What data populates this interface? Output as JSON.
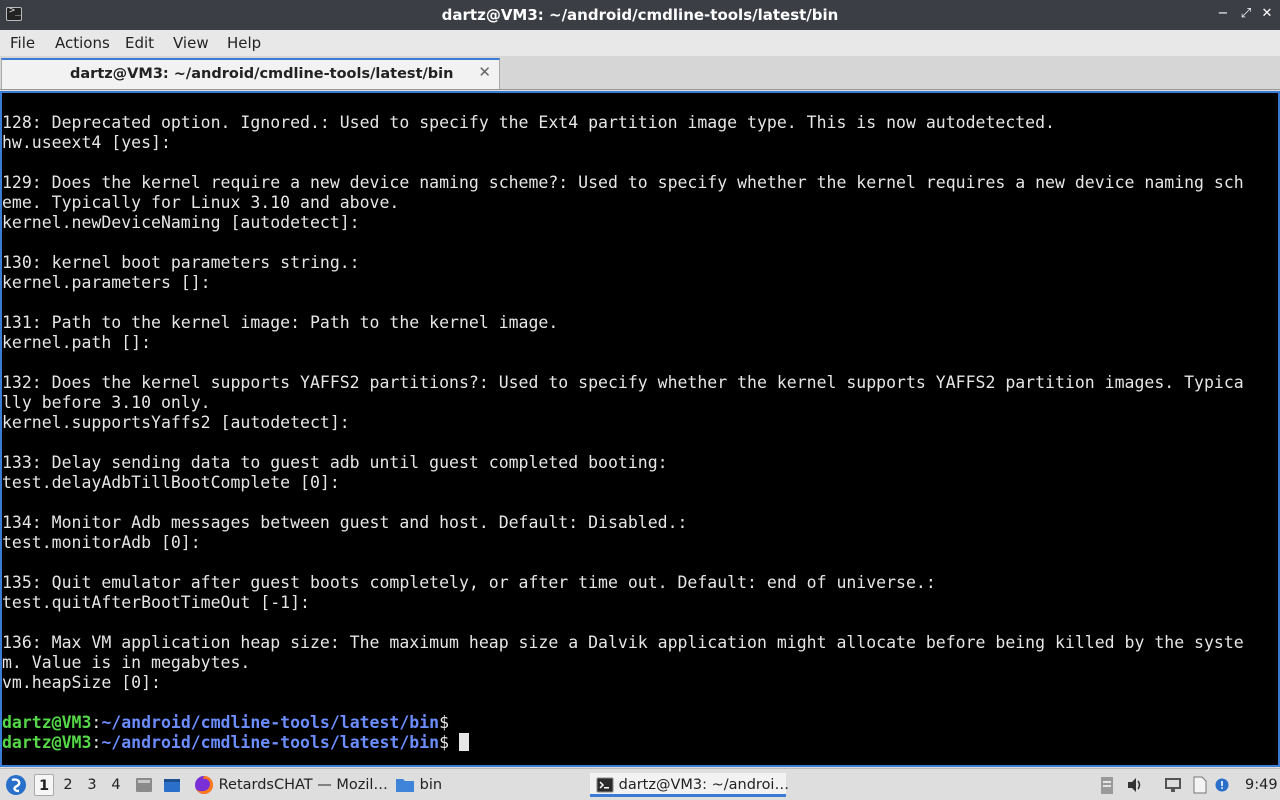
{
  "window": {
    "title": "dartz@VM3: ~/android/cmdline-tools/latest/bin",
    "app_icon_glyph": ">_",
    "controls": {
      "minimize": "−",
      "restore": "⤢",
      "close": "✕"
    }
  },
  "menu": [
    "File",
    "Actions",
    "Edit",
    "View",
    "Help"
  ],
  "tab": {
    "label": "dartz@VM3: ~/android/cmdline-tools/latest/bin",
    "close": "✕"
  },
  "terminal": {
    "lines": [
      "128: Deprecated option. Ignored.: Used to specify the Ext4 partition image type. This is now autodetected.",
      "hw.useext4 [yes]:",
      "",
      "129: Does the kernel require a new device naming scheme?: Used to specify whether the kernel requires a new device naming sch",
      "eme. Typically for Linux 3.10 and above.",
      "kernel.newDeviceNaming [autodetect]:",
      "",
      "130: kernel boot parameters string.:",
      "kernel.parameters []:",
      "",
      "131: Path to the kernel image: Path to the kernel image.",
      "kernel.path []:",
      "",
      "132: Does the kernel supports YAFFS2 partitions?: Used to specify whether the kernel supports YAFFS2 partition images. Typica",
      "lly before 3.10 only.",
      "kernel.supportsYaffs2 [autodetect]:",
      "",
      "133: Delay sending data to guest adb until guest completed booting:",
      "test.delayAdbTillBootComplete [0]:",
      "",
      "134: Monitor Adb messages between guest and host. Default: Disabled.:",
      "test.monitorAdb [0]:",
      "",
      "135: Quit emulator after guest boots completely, or after time out. Default: end of universe.:",
      "test.quitAfterBootTimeOut [-1]:",
      "",
      "136: Max VM application heap size: The maximum heap size a Dalvik application might allocate before being killed by the syste",
      "m. Value is in megabytes.",
      "vm.heapSize [0]:",
      ""
    ],
    "prompts": [
      {
        "user": "dartz@VM3",
        "sep": ":",
        "path": "~/android/cmdline-tools/latest/bin",
        "symbol": "$"
      },
      {
        "user": "dartz@VM3",
        "sep": ":",
        "path": "~/android/cmdline-tools/latest/bin",
        "symbol": "$ "
      }
    ]
  },
  "taskbar": {
    "workspaces": [
      "1",
      "2",
      "3",
      "4"
    ],
    "active_workspace": "1",
    "tasks": [
      {
        "label": "RetardsCHAT — Mozil…",
        "icon": "firefox-icon"
      },
      {
        "label": "bin",
        "icon": "folder-icon"
      },
      {
        "label": "dartz@VM3: ~/androi…",
        "icon": "terminal-icon"
      }
    ],
    "clock": "9:49"
  },
  "colors": {
    "titlebar": "#3b3f45",
    "terminal_bg": "#000000",
    "terminal_fg": "#e6e6e6",
    "prompt_user": "#55d948",
    "prompt_path": "#6b8dff",
    "accent": "#3a7bd5"
  }
}
